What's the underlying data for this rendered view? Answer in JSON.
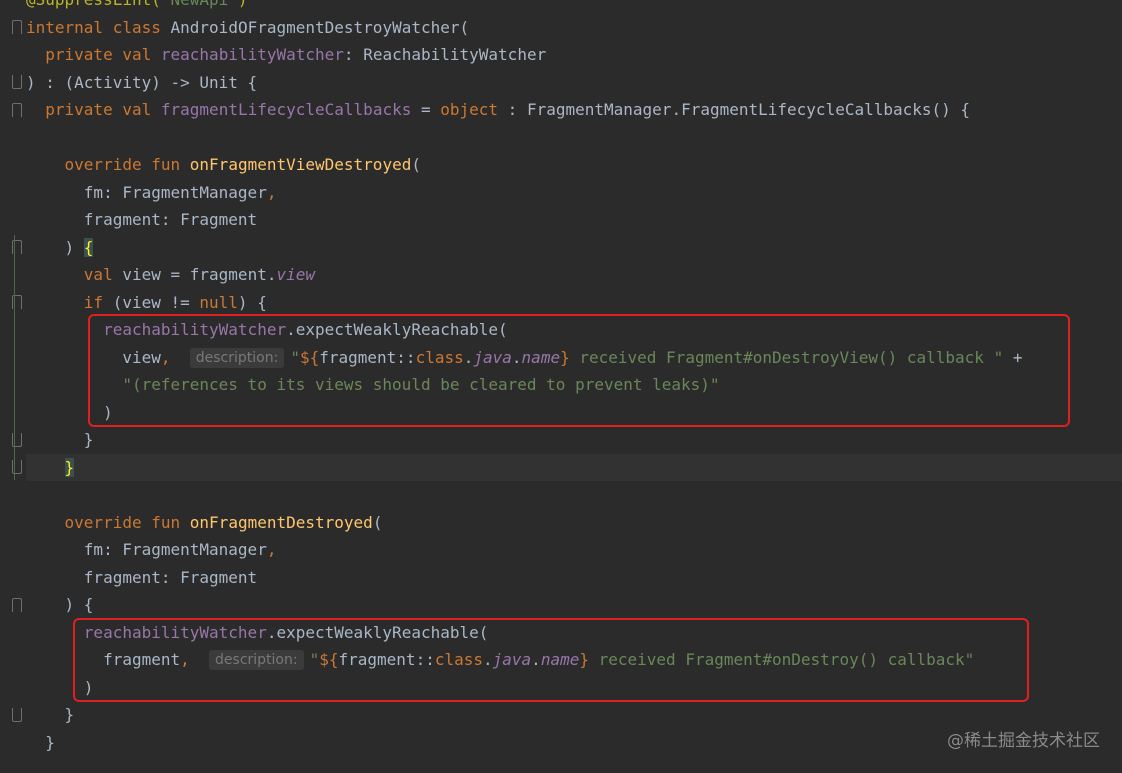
{
  "editor": {
    "lines": {
      "l0": {
        "annotation": "@SuppressLint(",
        "arg": "\"NewApi\"",
        "close": ")"
      },
      "l1": {
        "kw1": "internal",
        "kw2": "class",
        "name": "AndroidOFragmentDestroyWatcher("
      },
      "l2": {
        "kw1": "private",
        "kw2": "val",
        "prop": "reachabilityWatcher",
        "rest": ": ReachabilityWatcher"
      },
      "l3": {
        "text": ") : (Activity) -> Unit {"
      },
      "l4": {
        "kw1": "private",
        "kw2": "val",
        "prop": "fragmentLifecycleCallbacks",
        "eq": " = ",
        "kw3": "object",
        "rest": " : FragmentManager.FragmentLifecycleCallbacks() {"
      },
      "l6": {
        "kw1": "override",
        "kw2": "fun",
        "fn": "onFragmentViewDestroyed",
        "paren": "("
      },
      "l7": {
        "text": "fm: FragmentManager",
        "comma": ","
      },
      "l8": {
        "text": "fragment: Fragment"
      },
      "l9": {
        "text": ") ",
        "brace": "{"
      },
      "l10": {
        "kw": "val",
        "text": " view = fragment.",
        "prop": "view"
      },
      "l11": {
        "kw": "if",
        "text": " (view != ",
        "kw2": "null",
        "rest": ") {"
      },
      "l12": {
        "prop": "reachabilityWatcher",
        "rest": ".expectWeaklyReachable("
      },
      "l13": {
        "arg": "view",
        "comma": ",",
        "hint": "description:",
        "q": "\"",
        "interp1": "${",
        "tmpl_a": "fragment::",
        "tmpl_kw": "class",
        "tmpl_dot": ".",
        "tmpl_java": "java",
        "tmpl_dot2": ".",
        "tmpl_name": "name",
        "interp2": "}",
        "str": " received Fragment#onDestroyView() callback \"",
        "plus": " +"
      },
      "l14": {
        "str": "\"(references to its views should be cleared to prevent leaks)\""
      },
      "l15": {
        "text": ")"
      },
      "l16": {
        "text": "}"
      },
      "l17": {
        "brace": "}"
      },
      "l19": {
        "kw1": "override",
        "kw2": "fun",
        "fn": "onFragmentDestroyed",
        "paren": "("
      },
      "l20": {
        "text": "fm: FragmentManager",
        "comma": ","
      },
      "l21": {
        "text": "fragment: Fragment"
      },
      "l22": {
        "text": ") {"
      },
      "l23": {
        "prop": "reachabilityWatcher",
        "rest": ".expectWeaklyReachable("
      },
      "l24": {
        "arg": "fragment",
        "comma": ",",
        "hint": "description:",
        "q": "\"",
        "interp1": "${",
        "tmpl_a": "fragment::",
        "tmpl_kw": "class",
        "tmpl_dot": ".",
        "tmpl_java": "java",
        "tmpl_dot2": ".",
        "tmpl_name": "name",
        "interp2": "}",
        "str": " received Fragment#onDestroy() callback\""
      },
      "l25": {
        "text": ")"
      },
      "l26": {
        "text": "}"
      },
      "l27": {
        "text": "}"
      }
    }
  },
  "watermark": "@稀土掘金技术社区",
  "colors": {
    "highlight_box": "#e0201e",
    "keyword": "#cc7832",
    "function": "#ffc66d",
    "property": "#9876aa",
    "string": "#6a8759"
  },
  "icons": {
    "gutter_bulb": "lightbulb-icon"
  }
}
